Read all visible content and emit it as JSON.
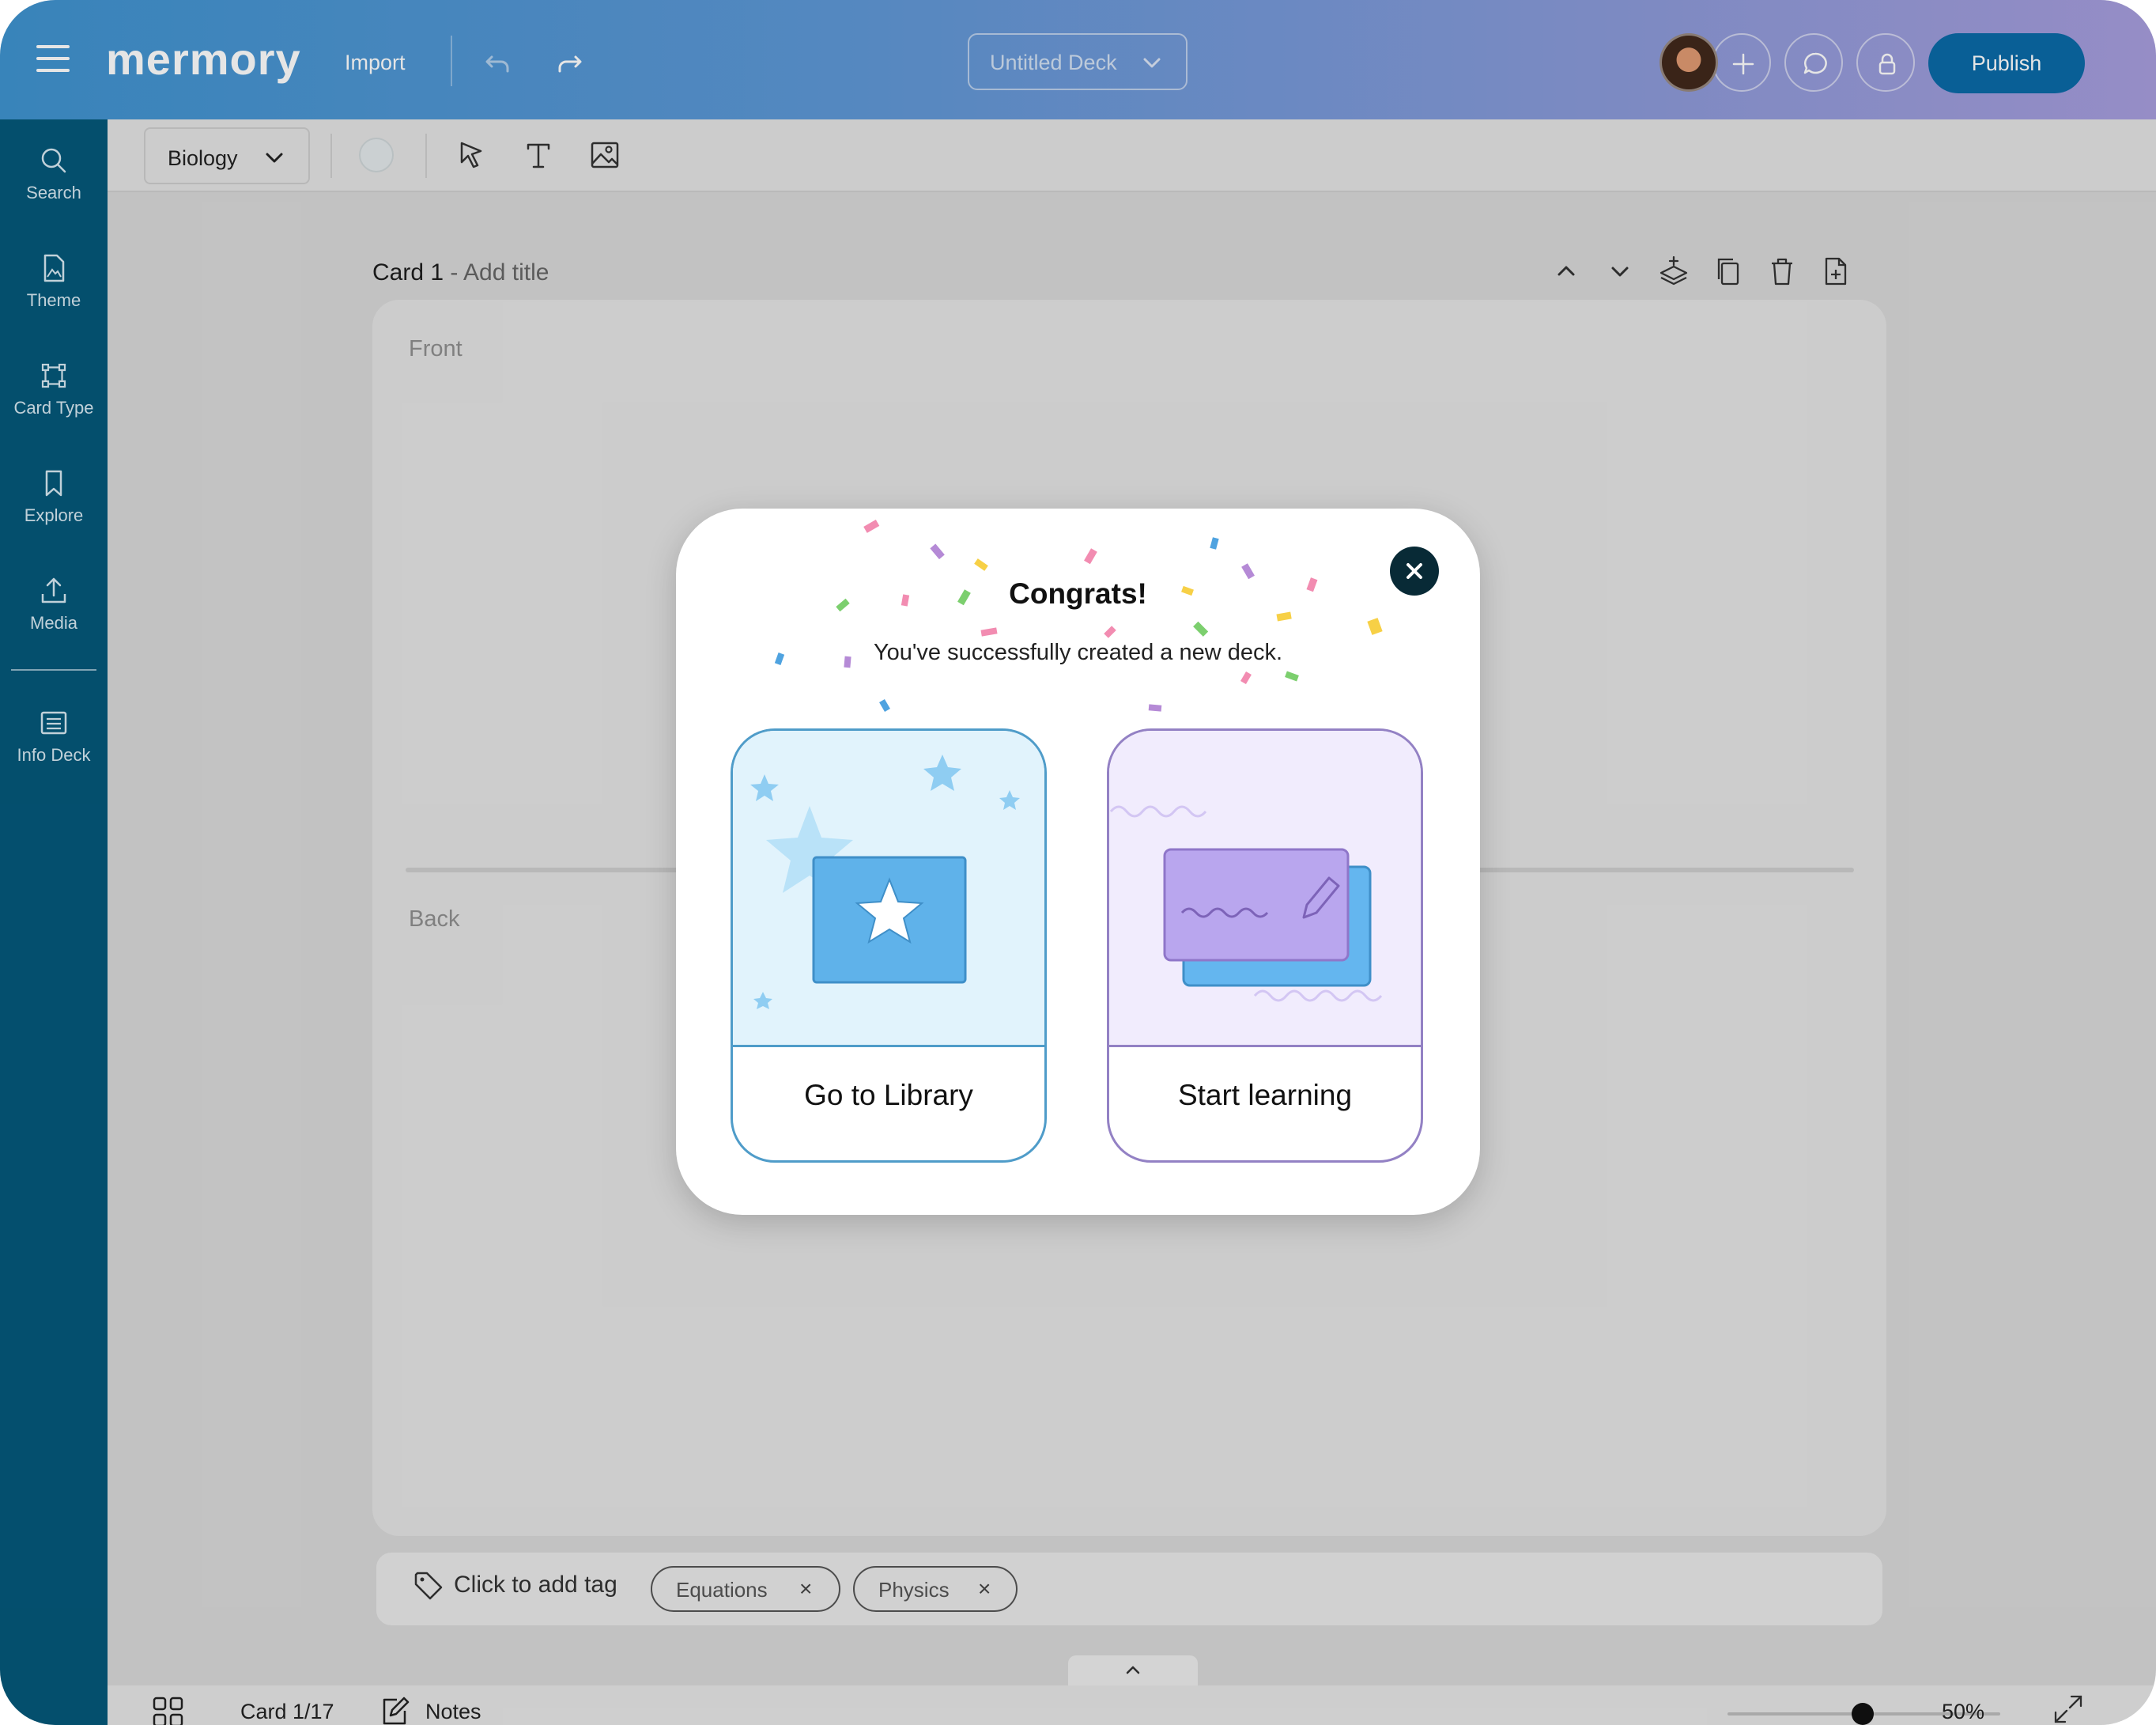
{
  "topbar": {
    "logo": "mermory",
    "import_label": "Import",
    "deck_name": "Untitled Deck",
    "publish_label": "Publish"
  },
  "sidebar": {
    "items": [
      {
        "label": "Search",
        "icon": "search-icon"
      },
      {
        "label": "Theme",
        "icon": "theme-icon"
      },
      {
        "label": "Card Type",
        "icon": "card-type-icon"
      },
      {
        "label": "Explore",
        "icon": "bookmark-icon"
      },
      {
        "label": "Media",
        "icon": "upload-icon"
      },
      {
        "label": "Info Deck",
        "icon": "info-deck-icon"
      }
    ]
  },
  "toolbar": {
    "subject": "Biology"
  },
  "card": {
    "number_label": "Card 1",
    "title_placeholder": " - Add title",
    "front_label": "Front",
    "back_label": "Back"
  },
  "tags": {
    "add_label": "Click to add tag",
    "items": [
      "Equations",
      "Physics"
    ],
    "remove_glyph": "×"
  },
  "statusbar": {
    "card_counter": "Card 1/17",
    "notes_label": "Notes",
    "zoom": "50%"
  },
  "modal": {
    "title": "Congrats!",
    "subtitle": "You've successfully created a new deck.",
    "library_label": "Go to Library",
    "learn_label": "Start learning"
  },
  "colors": {
    "sidebar": "#05587a",
    "publish": "#0b6aa8",
    "library_accent": "#4f9cc9",
    "learn_accent": "#9381c4"
  }
}
